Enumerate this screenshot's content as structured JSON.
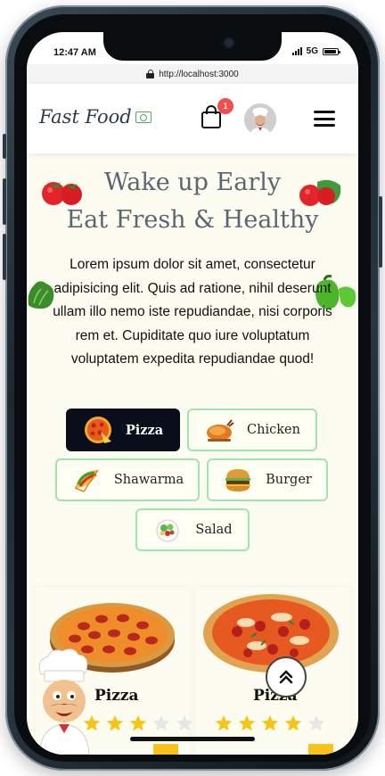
{
  "status_bar": {
    "time": "12:47 AM",
    "network": "5G"
  },
  "browser": {
    "url": "http://localhost:3000"
  },
  "header": {
    "brand": "Fast Food",
    "cart_count": "1"
  },
  "hero": {
    "title_line1": "Wake up Early",
    "title_line2": "Eat Fresh & Healthy",
    "description": "Lorem ipsum dolor sit amet, consectetur adipisicing elit. Quis ad ratione, nihil deserunt ullam illo nemo iste repudiandae, nisi corporis rem et. Cupiditate quo iure voluptatum voluptatem expedita repudiandae quod!"
  },
  "categories": [
    {
      "label": "Pizza",
      "icon": "pizza-icon",
      "active": true
    },
    {
      "label": "Chicken",
      "icon": "chicken-icon",
      "active": false
    },
    {
      "label": "Shawarma",
      "icon": "shawarma-icon",
      "active": false
    },
    {
      "label": "Burger",
      "icon": "burger-icon",
      "active": false
    },
    {
      "label": "Salad",
      "icon": "salad-icon",
      "active": false
    }
  ],
  "products": [
    {
      "name": "Pizza",
      "rating": 3,
      "max_rating": 5
    },
    {
      "name": "Pizza",
      "rating": 4,
      "max_rating": 5
    }
  ],
  "colors": {
    "accent_green": "#9fe3b2",
    "active_chip": "#0a0e1a",
    "badge_red": "#ef4f4f",
    "star_yellow": "#f5c518",
    "page_bg": "#fdfcf1",
    "hero_text": "#5b6672"
  }
}
